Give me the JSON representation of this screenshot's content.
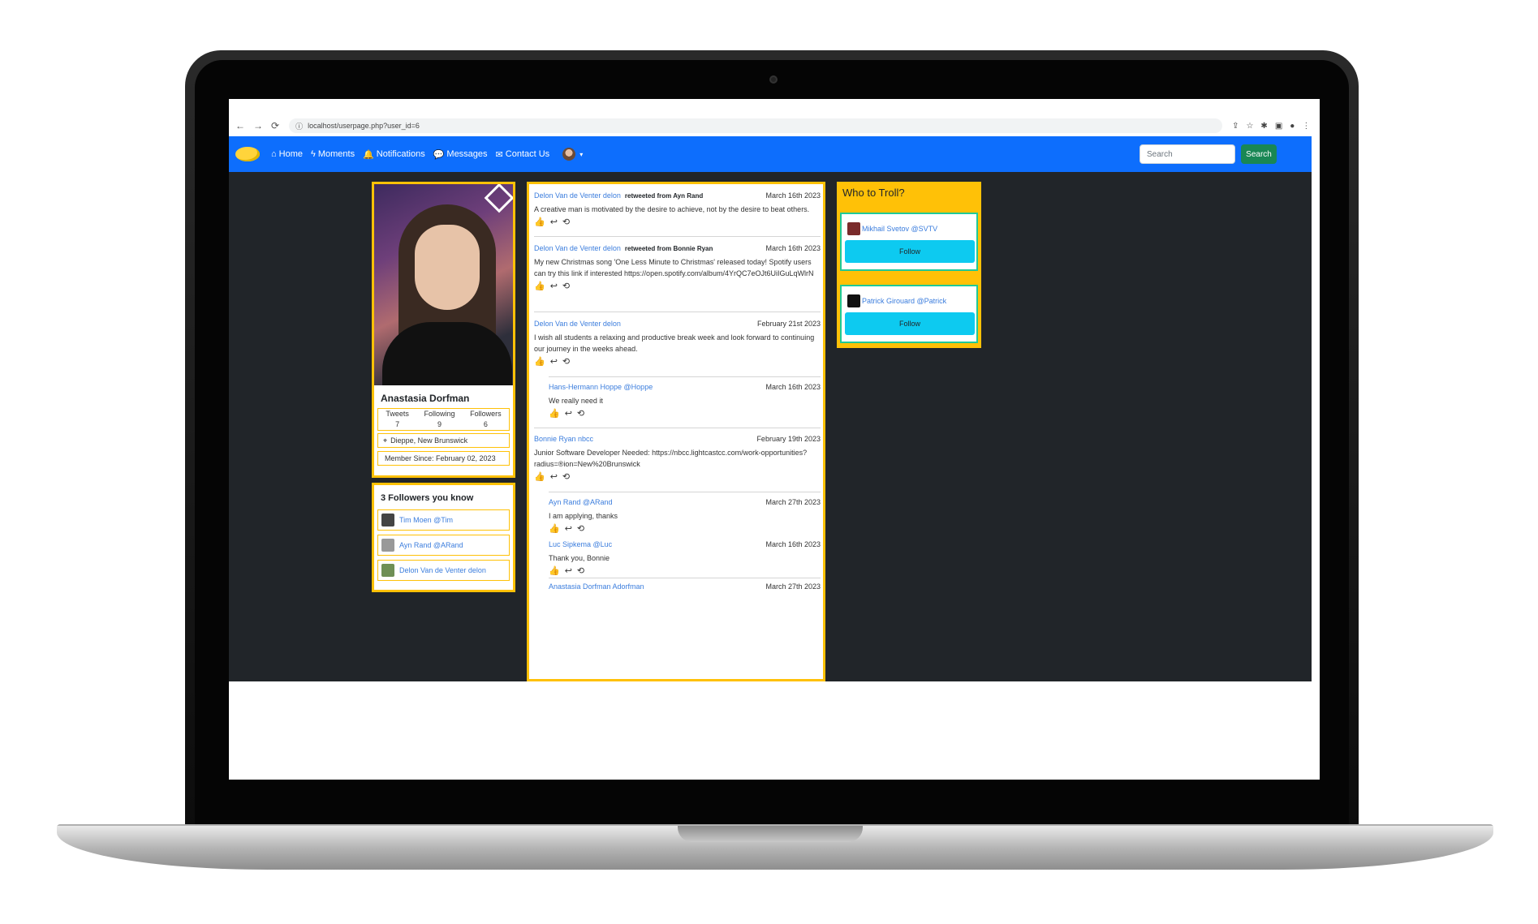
{
  "browser": {
    "url": "localhost/userpage.php?user_id=6",
    "nav": [
      "←",
      "→",
      "⟳"
    ],
    "url_icon": "ⓘ",
    "extensions": [
      "⇪",
      "☆",
      "✱",
      "▣",
      "●",
      "⋮"
    ]
  },
  "navbar": {
    "items": [
      {
        "label": "Home",
        "icon": "⌂"
      },
      {
        "label": "Moments",
        "icon": "ϟ"
      },
      {
        "label": "Notifications",
        "icon": "🔔"
      },
      {
        "label": "Messages",
        "icon": "💬"
      },
      {
        "label": "Contact Us",
        "icon": "✉"
      }
    ],
    "caret": "▾",
    "search_placeholder": "Search",
    "search_button": "Search"
  },
  "profile": {
    "name": "Anastasia Dorfman",
    "stats": [
      {
        "label": "Tweets",
        "value": "7"
      },
      {
        "label": "Following",
        "value": "9"
      },
      {
        "label": "Followers",
        "value": "6"
      }
    ],
    "location_icon": "⌖",
    "location": "Dieppe, New Brunswick",
    "member_since": "Member Since: February 02, 2023"
  },
  "followers_you_know": {
    "title": "3 Followers you know",
    "items": [
      "Tim Moen @Tim",
      "Ayn Rand @ARand",
      "Delon Van de Venter delon"
    ]
  },
  "feed": {
    "actions": [
      "👍",
      "↩",
      "⟲"
    ],
    "tweets": [
      {
        "author": "Delon Van de Venter delon",
        "retweet": "retweeted from Ayn Rand",
        "date": "March 16th 2023",
        "text": "A creative man is motivated by the desire to achieve, not by the desire to beat others."
      },
      {
        "author": "Delon Van de Venter delon",
        "retweet": "retweeted from Bonnie Ryan",
        "date": "March 16th 2023",
        "text": "My new Christmas song 'One Less Minute to Christmas' released today! Spotify users can try this link if interested https://open.spotify.com/album/4YrQC7eOJt6UiIGuLqWlrN"
      },
      {
        "author": "Delon Van de Venter delon",
        "retweet": "",
        "date": "February 21st 2023",
        "text": "I wish all students a relaxing and productive break week and look forward to continuing our journey in the weeks ahead."
      },
      {
        "author": "Hans-Hermann Hoppe @Hoppe",
        "retweet": "",
        "date": "March 16th 2023",
        "text": "We really need it"
      },
      {
        "author": "Bonnie Ryan nbcc",
        "retweet": "",
        "date": "February 19th 2023",
        "text": "Junior Software Developer Needed: https://nbcc.lightcastcc.com/work-opportunities?radius=®ion=New%20Brunswick"
      },
      {
        "author": "Ayn Rand @ARand",
        "retweet": "",
        "date": "March 27th 2023",
        "text": "I am applying, thanks"
      },
      {
        "author": "Luc Sipkema @Luc",
        "retweet": "",
        "date": "March 16th 2023",
        "text": "Thank you, Bonnie"
      },
      {
        "author": "Anastasia Dorfman Adorfman",
        "retweet": "",
        "date": "March 27th 2023",
        "text": ""
      }
    ]
  },
  "troll": {
    "title": "Who to Troll?",
    "suggestions": [
      {
        "name": "Mikhail Svetov @SVTV",
        "button": "Follow"
      },
      {
        "name": "Patrick Girouard @Patrick",
        "button": "Follow"
      }
    ]
  }
}
